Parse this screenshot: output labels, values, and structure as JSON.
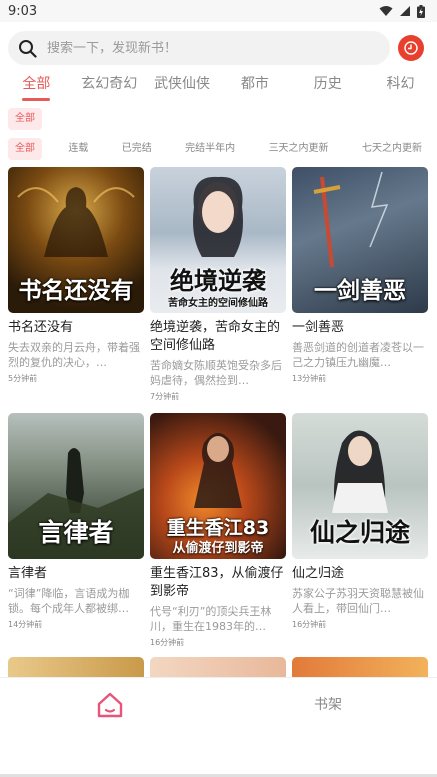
{
  "status_bar": {
    "time": "9:03"
  },
  "search": {
    "placeholder": "搜索一下，发现新书！"
  },
  "categories": [
    "全部",
    "玄幻奇幻",
    "武侠仙侠",
    "都市",
    "历史",
    "科幻"
  ],
  "filter1": [
    "全部"
  ],
  "filter2": [
    "全部",
    "连载",
    "已完结",
    "完结半年内",
    "三天之内更新",
    "七天之内更新"
  ],
  "books": [
    {
      "cover_text": "书名还没有",
      "cover_sub": "",
      "title": "书名还没有",
      "desc": "失去双亲的月云舟，带着强烈的复仇的决心，…",
      "time": "5分钟前"
    },
    {
      "cover_text": "绝境逆袭",
      "cover_sub": "苦命女主的空间修仙路",
      "title": "绝境逆袭，苦命女主的空间修仙路",
      "desc": "苦命嫡女陈顺英饱受杂多后妈虐待，偶然捡到…",
      "time": "7分钟前"
    },
    {
      "cover_text": "一剑善恶",
      "cover_sub": "",
      "title": "一剑善恶",
      "desc": "善恶剑道的创道者凌苍以一己之力镇压九幽魔…",
      "time": "13分钟前"
    },
    {
      "cover_text": "言律者",
      "cover_sub": "",
      "title": "言律者",
      "desc": "“词律”降临，言语成为枷锁。每个成年人都被绑…",
      "time": "14分钟前"
    },
    {
      "cover_text": "重生香江83",
      "cover_sub": "从偷渡仔到影帝",
      "title": "重生香江83，从偷渡仔到影帝",
      "desc": "代号“利刃”的顶尖兵王林川，重生在1983年的…",
      "time": "16分钟前"
    },
    {
      "cover_text": "仙之归途",
      "cover_sub": "",
      "title": "仙之归途",
      "desc": "苏家公子苏羽天资聪慧被仙人看上，带回仙门…",
      "time": "16分钟前"
    }
  ],
  "bottom_nav": {
    "shelf_label": "书架"
  },
  "colors": {
    "accent": "#e85a5a",
    "home_icon": "#e8557a",
    "clock_btn": "#e8402f"
  }
}
